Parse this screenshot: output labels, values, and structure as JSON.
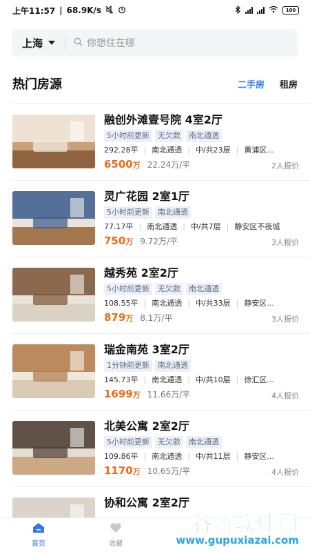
{
  "status_bar": {
    "time": "上午11:57",
    "speed": "68.9K/s",
    "battery": "100"
  },
  "search": {
    "city": "上海",
    "placeholder": "你想住在哪"
  },
  "section": {
    "title": "热门房源",
    "tabs": [
      "二手房",
      "租房"
    ],
    "active_tab": "二手房"
  },
  "listings": [
    {
      "title": "融创外滩壹号院 4室2厅",
      "tags": [
        "5小时前更新",
        "无欠款",
        "南北通透"
      ],
      "area": "292.28平",
      "orientation": "南北通透",
      "floor": "中/共23层",
      "district": "黄浦区...",
      "price": "6500",
      "price_unit": "万",
      "unit_price": "22.24万/平",
      "inquiries": "2人报价"
    },
    {
      "title": "灵广花园 2室1厅",
      "tags": [
        "5小时前更新",
        "南北通透"
      ],
      "area": "77.17平",
      "orientation": "南北通透",
      "floor": "中/共7层",
      "district": "静安区不夜城",
      "price": "750",
      "price_unit": "万",
      "unit_price": "9.72万/平",
      "inquiries": "3人报价"
    },
    {
      "title": "越秀苑 2室2厅",
      "tags": [
        "5小时前更新",
        "无欠款",
        "南北通透"
      ],
      "area": "108.55平",
      "orientation": "南北通透",
      "floor": "中/共33层",
      "district": "静安区...",
      "price": "879",
      "price_unit": "万",
      "unit_price": "8.1万/平",
      "inquiries": "3人报价"
    },
    {
      "title": "瑞金南苑 3室2厅",
      "tags": [
        "1分钟前更新",
        "南北通透"
      ],
      "area": "145.73平",
      "orientation": "南北通透",
      "floor": "中/共10层",
      "district": "徐汇区...",
      "price": "1699",
      "price_unit": "万",
      "unit_price": "11.66万/平",
      "inquiries": "4人报价"
    },
    {
      "title": "北美公寓 2室2厅",
      "tags": [
        "5小时前更新",
        "无欠款",
        "南北通透"
      ],
      "area": "109.86平",
      "orientation": "南北通透",
      "floor": "中/共11层",
      "district": "静安区...",
      "price": "1170",
      "price_unit": "万",
      "unit_price": "10.65万/平",
      "inquiries": "4人报价"
    },
    {
      "title": "协和公寓 2室2厅",
      "tags": [],
      "area": "",
      "orientation": "",
      "floor": "",
      "district": "",
      "price": "",
      "price_unit": "",
      "unit_price": "",
      "inquiries": ""
    }
  ],
  "nav": {
    "home": "首页",
    "favorites": "收藏"
  },
  "watermark": {
    "brand": "谷普软件园",
    "url": "www.gupuxiazai.com"
  },
  "colors": {
    "accent": "#2f7ce0",
    "price": "#f06a16",
    "watermark": "#2aa5e3"
  }
}
